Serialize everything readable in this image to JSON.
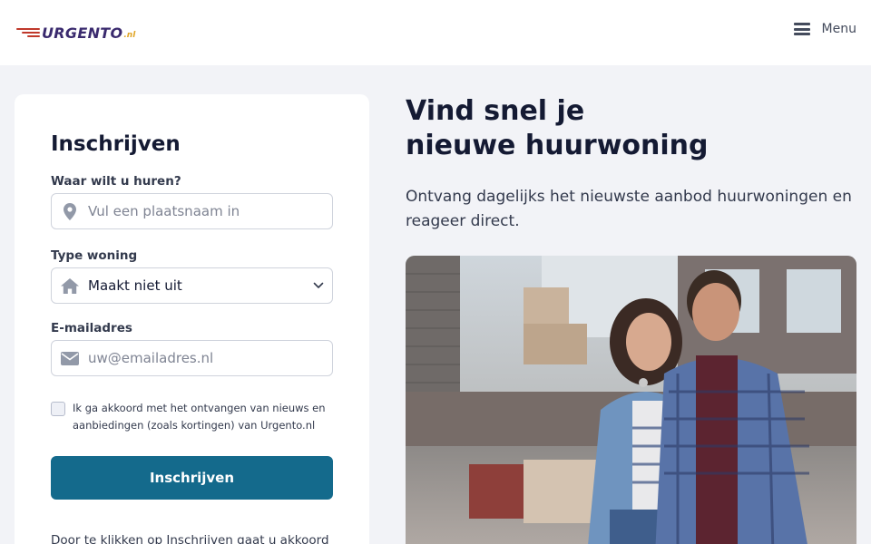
{
  "header": {
    "logo_text": "URGENTO",
    "logo_tld": ".nl",
    "menu_label": "Menu"
  },
  "form": {
    "title": "Inschrijven",
    "location": {
      "label": "Waar wilt u huren?",
      "placeholder": "Vul een plaatsnaam in",
      "value": ""
    },
    "type": {
      "label": "Type woning",
      "selected": "Maakt niet uit"
    },
    "email": {
      "label": "E-mailadres",
      "placeholder": "uw@emailadres.nl",
      "value": ""
    },
    "consent_text": "Ik ga akkoord met het ontvangen van nieuws en aanbiedingen (zoals kortingen) van Urgento.nl",
    "consent_checked": false,
    "submit_label": "Inschrijven",
    "terms_text": "Door te klikken op Inschrijven gaat u akkoord"
  },
  "hero": {
    "title_line1": "Vind snel je",
    "title_line2": "nieuwe huurwoning",
    "subtitle": "Ontvang dagelijks het nieuwste aanbod huurwoningen en reageer direct."
  },
  "icons": {
    "location": "map-pin-icon",
    "house": "house-icon",
    "email": "envelope-icon",
    "dropdown": "chevron-down-icon",
    "menu": "hamburger-icon"
  },
  "colors": {
    "primary_button": "#146a8c",
    "logo_text": "#3a2a6e",
    "logo_tld": "#e0a526",
    "logo_speed_lines": "#c0392b",
    "page_background": "#f2f3f7"
  }
}
